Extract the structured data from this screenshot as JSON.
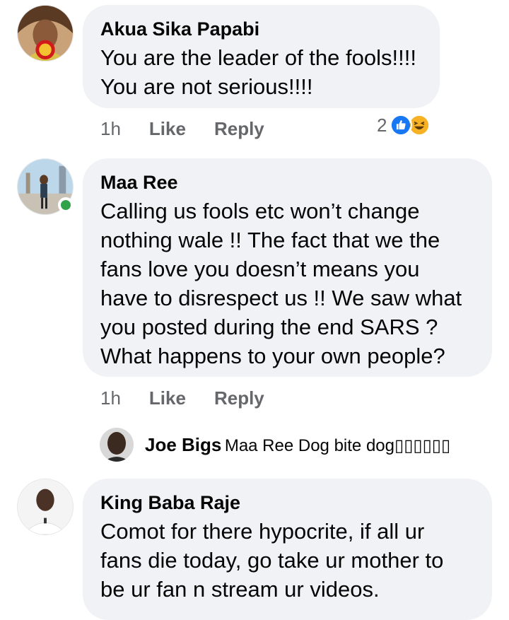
{
  "comments": [
    {
      "author": "Akua Sika Papabi",
      "lines": [
        "You are the leader of the fools!!!!",
        "You are not serious!!!!"
      ],
      "time": "1h",
      "like": "Like",
      "reply": "Reply",
      "reaction_count": "2"
    },
    {
      "author": "Maa Ree",
      "lines": [
        "Calling us fools etc won’t change",
        "nothing wale !! The fact that we the",
        "fans love you doesn’t means you",
        "have to disrespect us !! We saw what",
        "you posted during the end SARS ?",
        "What happens to your own people?"
      ],
      "time": "1h",
      "like": "Like",
      "reply": "Reply",
      "online": true
    },
    {
      "author": "King Baba Raje",
      "lines": [
        "Comot for there hypocrite, if all ur",
        "fans die today, go take ur mother to",
        "be ur fan n stream ur videos."
      ]
    }
  ],
  "reply_preview": {
    "author": "Joe Bigs",
    "text": "Maa Ree Dog bite dog▯▯▯▯▯▯"
  },
  "colors": {
    "bubble": "#f0f2f5",
    "meta": "#65676b",
    "like_blue": "#1877f2",
    "haha_yellow": "#f7b125",
    "online_green": "#31a24c"
  },
  "icons": [
    "like-reaction-icon",
    "haha-reaction-icon"
  ]
}
